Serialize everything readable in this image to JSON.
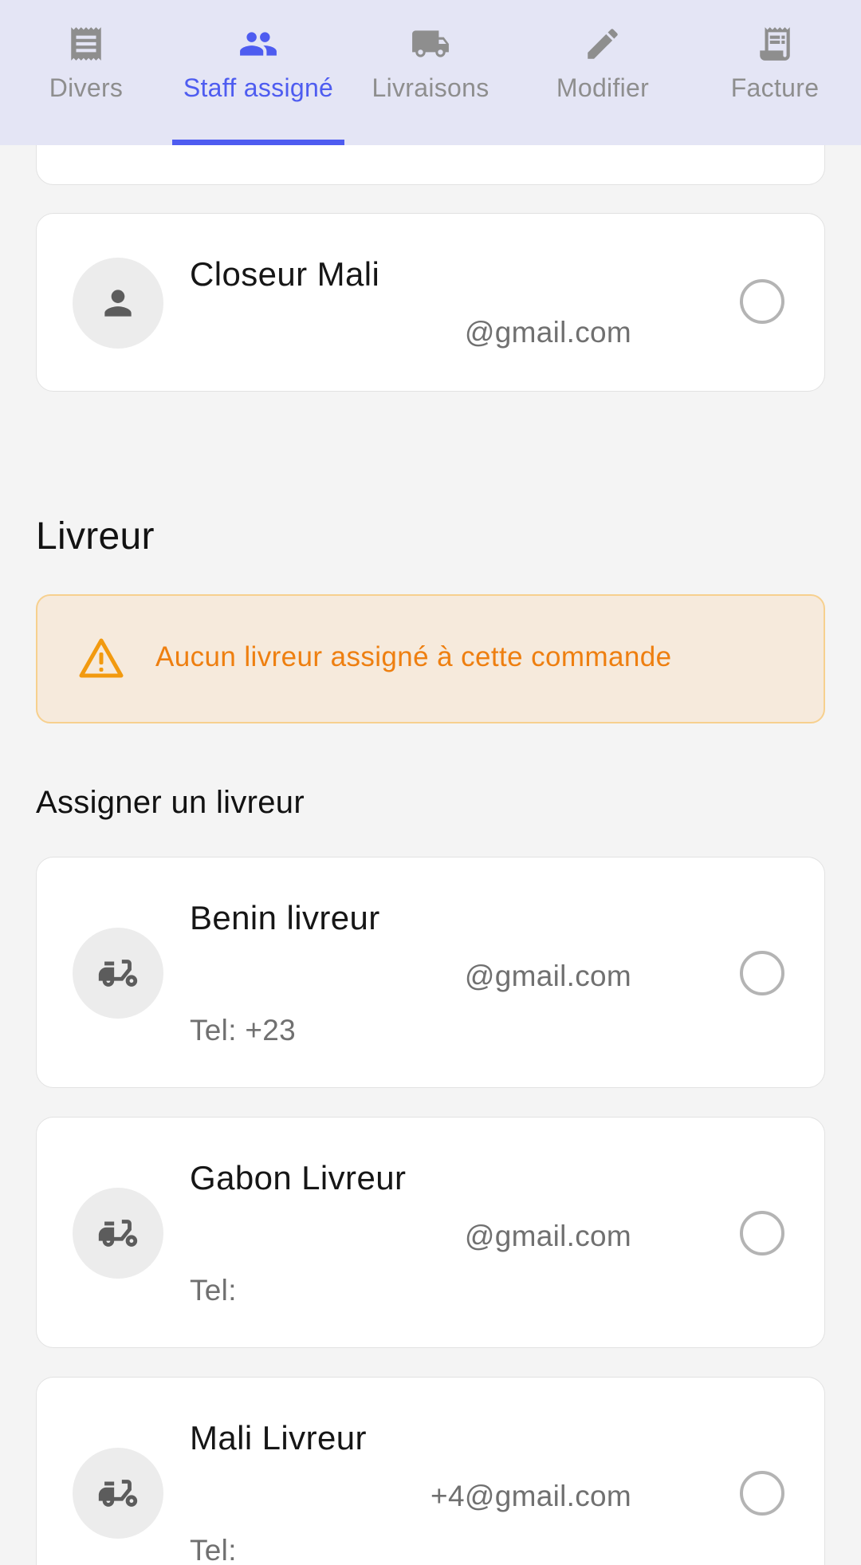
{
  "tabs": [
    {
      "label": "Divers",
      "icon": "receipt-icon",
      "active": false
    },
    {
      "label": "Staff assigné",
      "icon": "people-icon",
      "active": true
    },
    {
      "label": "Livraisons",
      "icon": "truck-icon",
      "active": false
    },
    {
      "label": "Modifier",
      "icon": "pencil-icon",
      "active": false
    },
    {
      "label": "Facture",
      "icon": "invoice-icon",
      "active": false
    }
  ],
  "closeur": {
    "name": "Closeur Mali",
    "email": "@gmail.com"
  },
  "livreur_section": {
    "title": "Livreur",
    "alert": "Aucun livreur assigné à cette commande",
    "assign_title": "Assigner un livreur"
  },
  "livreurs": [
    {
      "name": "Benin livreur",
      "email": "@gmail.com",
      "tel": "Tel: +23"
    },
    {
      "name": "Gabon Livreur",
      "email": "@gmail.com",
      "tel": "Tel:"
    },
    {
      "name": "Mali Livreur",
      "email": "+4@gmail.com",
      "tel": "Tel:"
    }
  ],
  "colors": {
    "accent": "#4e5cf0",
    "tab_bar": "#e4e5f5",
    "warning_text": "#ee7f10",
    "warning_bg": "#f6eadc",
    "warning_border": "#f7d08e"
  }
}
